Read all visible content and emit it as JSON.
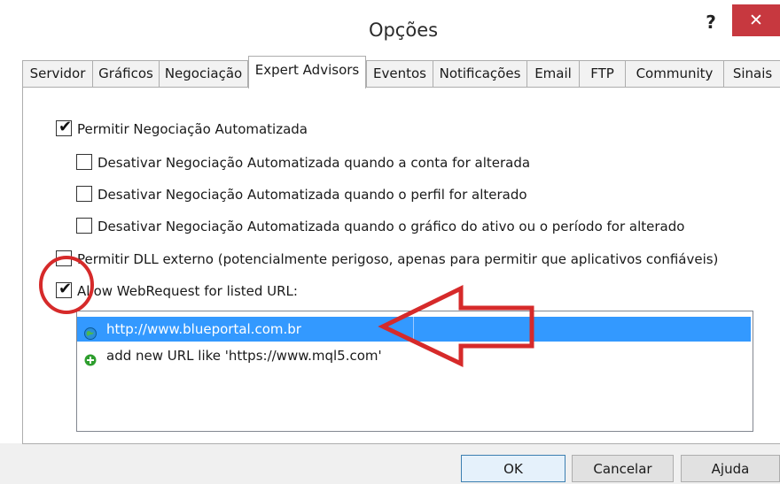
{
  "window": {
    "title": "Opções",
    "help_label": "?",
    "close_label": "✕"
  },
  "tabs": [
    {
      "label": "Servidor"
    },
    {
      "label": "Gráficos"
    },
    {
      "label": "Negociação"
    },
    {
      "label": "Expert Advisors",
      "active": true
    },
    {
      "label": "Eventos"
    },
    {
      "label": "Notificações"
    },
    {
      "label": "Email"
    },
    {
      "label": "FTP"
    },
    {
      "label": "Community"
    },
    {
      "label": "Sinais"
    }
  ],
  "options": {
    "allow_auto": {
      "label": "Permitir Negociação Automatizada",
      "checked": true
    },
    "disable_account": {
      "label": "Desativar Negociação Automatizada quando a conta for alterada",
      "checked": false
    },
    "disable_profile": {
      "label": "Desativar Negociação Automatizada quando o perfil for alterado",
      "checked": false
    },
    "disable_chart": {
      "label": "Desativar Negociação Automatizada quando o gráfico do ativo ou o período for alterado",
      "checked": false
    },
    "allow_dll": {
      "label": "Permitir DLL externo (potencialmente perigoso, apenas para permitir que aplicativos confiáveis)",
      "checked": false
    },
    "allow_webrequest": {
      "label": "Allow WebRequest for listed URL:",
      "checked": true
    }
  },
  "url_list": {
    "items": [
      {
        "text": "http://www.blueportal.com.br",
        "selected": true,
        "icon": "globe-icon"
      },
      {
        "text": "add new URL like 'https://www.mql5.com'",
        "selected": false,
        "icon": "add-icon"
      }
    ]
  },
  "buttons": {
    "ok": "OK",
    "cancel": "Cancelar",
    "help": "Ajuda"
  },
  "colors": {
    "close_red": "#c7383f",
    "selection_blue": "#3399ff",
    "annotation_red": "#d62a2a",
    "add_green": "#2e9e2e"
  }
}
